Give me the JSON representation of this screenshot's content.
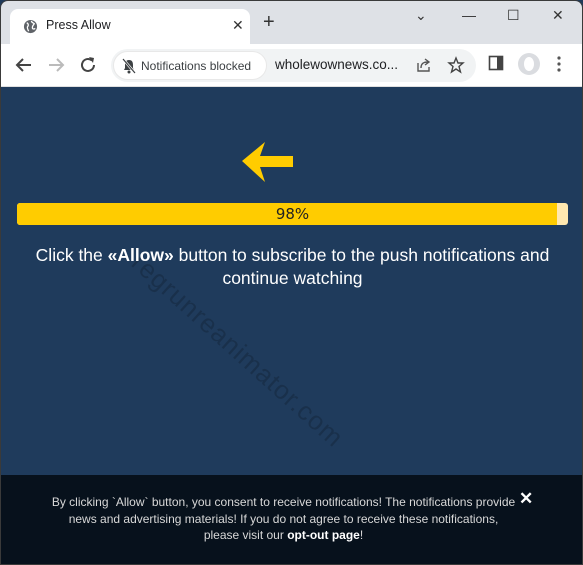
{
  "browser": {
    "tab": {
      "title": "Press Allow",
      "favicon": "globe-icon",
      "close_glyph": "✕"
    },
    "new_tab_glyph": "+",
    "window_controls": {
      "tab_search": "⌄",
      "minimize": "—",
      "maximize": "☐",
      "close": "✕"
    },
    "omnibox": {
      "permission_chip": "Notifications blocked",
      "url": "wholewownews.co..."
    }
  },
  "page": {
    "progress": {
      "percent": 98,
      "label": "98%"
    },
    "headline": {
      "prefix": "Click the ",
      "emphasis": "«Allow»",
      "suffix": " button to subscribe to the push notifications and continue watching"
    },
    "watermark": "regrunreanimator.com",
    "colors": {
      "background": "#1f3b5c",
      "accent": "#ffcc00",
      "footer": "#07111c"
    }
  },
  "footer": {
    "text_before": "By clicking `Allow` button, you consent to receive notifications! The notifications provide news and advertising materials! If you do not agree to receive these notifications, please visit our ",
    "link": "opt-out page",
    "text_after": "!",
    "close_glyph": "✕"
  }
}
